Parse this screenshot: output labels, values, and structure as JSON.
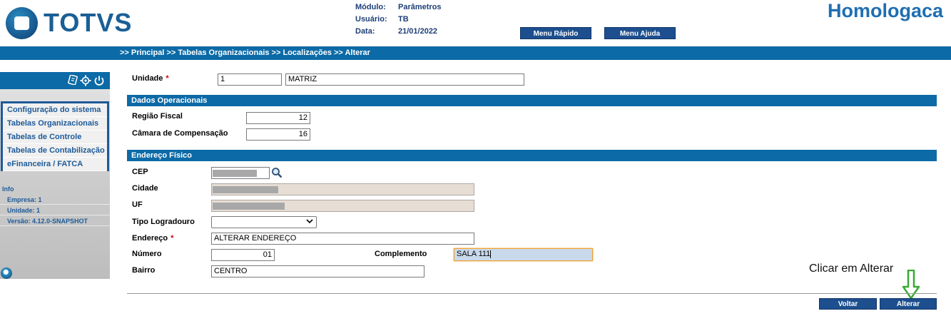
{
  "brand": {
    "name": "TOTVS"
  },
  "environment_title": "Homologaca",
  "header": {
    "modulo_label": "Módulo:",
    "modulo_value": "Parâmetros",
    "usuario_label": "Usuário:",
    "usuario_value": "TB",
    "data_label": "Data:",
    "data_value": "21/01/2022",
    "menu_rapido": "Menu Rápido",
    "menu_ajuda": "Menu Ajuda"
  },
  "breadcrumb": ">> Principal >> Tabelas Organizacionais >> Localizações >> Alterar",
  "sidebar": {
    "icons": [
      "calculator-icon",
      "gear-icon",
      "power-icon"
    ],
    "items": [
      {
        "label": "Configuração do sistema"
      },
      {
        "label": "Tabelas Organizacionais"
      },
      {
        "label": "Tabelas de Controle"
      },
      {
        "label": "Tabelas de Contabilização"
      },
      {
        "label": "eFinanceira / FATCA"
      }
    ],
    "info_title": "Info",
    "info": {
      "empresa": "Empresa: 1",
      "unidade": "Unidade: 1",
      "versao": "Versão: 4.12.0-SNAPSHOT"
    }
  },
  "form": {
    "unidade_label": "Unidade",
    "unidade_code": "1",
    "unidade_name": "MATRIZ",
    "required_mark": "*",
    "dados_operacionais": "Dados Operacionais",
    "regiao_fiscal_label": "Região Fiscal",
    "regiao_fiscal_value": "12",
    "camara_label": "Câmara de Compensação",
    "camara_value": "16",
    "endereco_fisico": "Endereço Físico",
    "cep_label": "CEP",
    "cidade_label": "Cidade",
    "uf_label": "UF",
    "tipo_logradouro_label": "Tipo Logradouro",
    "tipo_logradouro_value": "",
    "endereco_label": "Endereço",
    "endereco_value": "ALTERAR ENDEREÇO",
    "numero_label": "Número",
    "numero_value": "01",
    "complemento_label": "Complemento",
    "complemento_value": "SALA 111",
    "bairro_label": "Bairro",
    "bairro_value": "CENTRO"
  },
  "note": "Clicar em Alterar",
  "actions": {
    "voltar": "Voltar",
    "alterar": "Alterar"
  },
  "colors": {
    "primary_blue": "#0c6aa6",
    "button_blue": "#1d4f8f",
    "arrow_green": "#3aa935",
    "focus_orange": "#f0a030"
  }
}
